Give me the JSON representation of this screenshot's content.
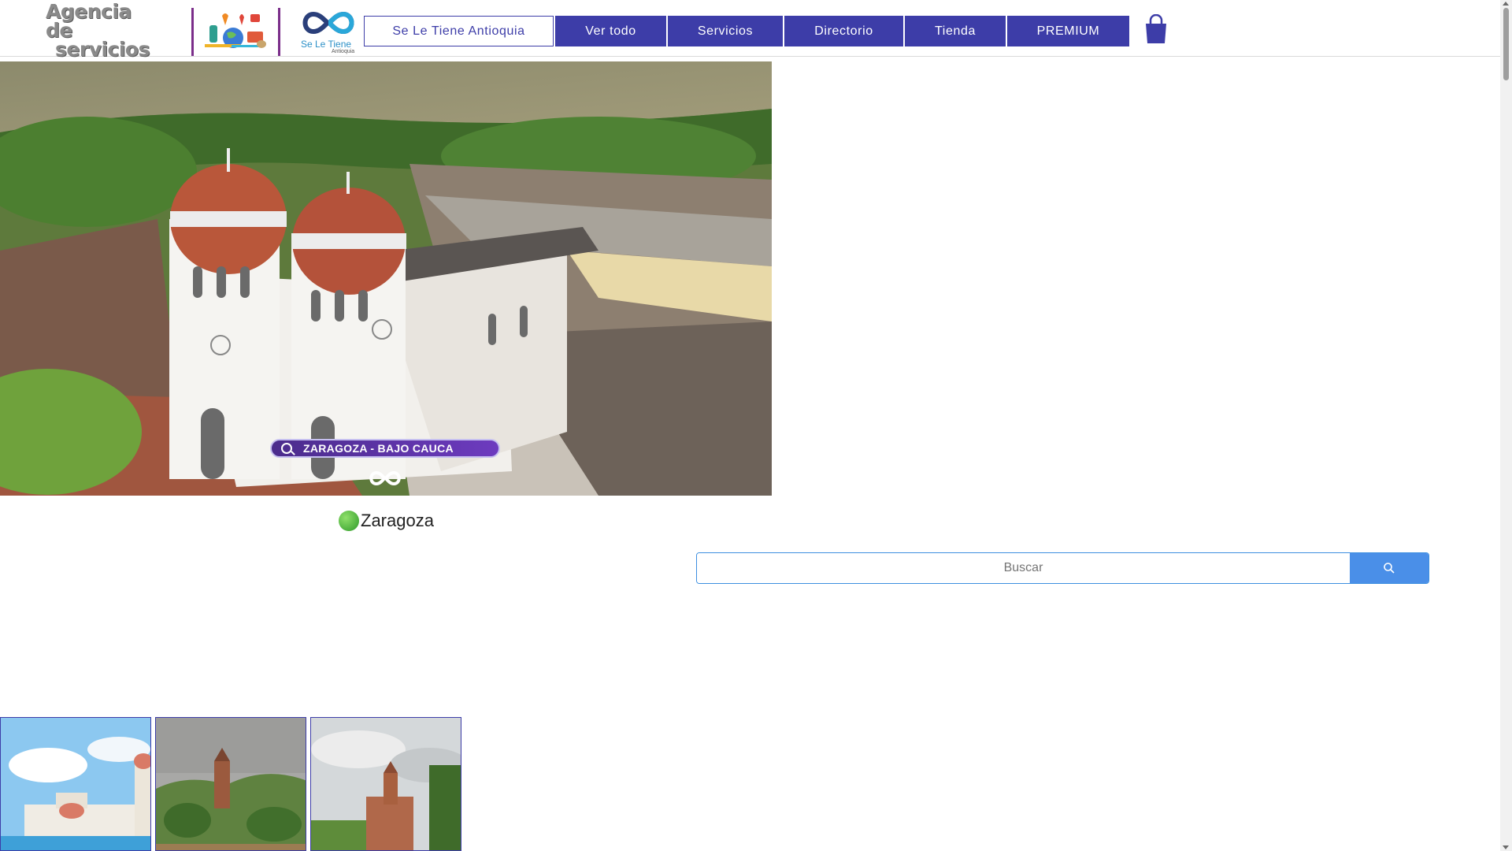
{
  "header": {
    "logo_agencia_line1": "Agencia de",
    "logo_agencia_line2": "servicios",
    "logo_sle_text": "Se Le Tiene",
    "logo_sle_sub": "Antioquia",
    "nav": [
      {
        "label": "Se Le Tiene Antioquia",
        "active": true
      },
      {
        "label": "Ver todo"
      },
      {
        "label": "Servicios"
      },
      {
        "label": "Directorio"
      },
      {
        "label": "Tienda"
      },
      {
        "label": "PREMIUM"
      }
    ],
    "cart_icon": "shopping-bag-icon"
  },
  "hero": {
    "search_pill_text": "ZARAGOZA - BAJO CAUCA"
  },
  "town": {
    "title": "Zaragoza",
    "dot_icon": "green-circle-icon"
  },
  "search": {
    "placeholder": "Buscar",
    "button_icon": "search-icon"
  },
  "colors": {
    "nav_bg": "#3d3da8",
    "search_accent": "#4a8fe8",
    "dot_green": "#2f9a2a"
  }
}
